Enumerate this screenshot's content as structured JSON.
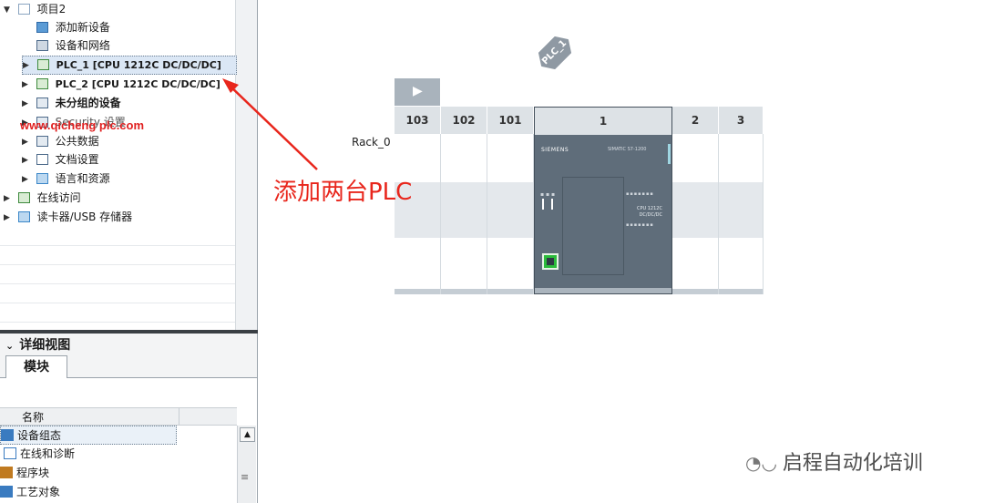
{
  "tree": {
    "items": [
      {
        "label": "项目2",
        "expander": "▼",
        "icon": "project-icon",
        "icon_color": "#8aa4c0"
      },
      {
        "label": "添加新设备",
        "icon": "add-device-icon",
        "icon_color": "#5b9bd5"
      },
      {
        "label": "设备和网络",
        "icon": "network-icon",
        "icon_color": "#4d6a8a"
      },
      {
        "label": "PLC_1 [CPU 1212C DC/DC/DC]",
        "expander": "▶",
        "icon": "plc-icon",
        "icon_color": "#3d8a3d"
      },
      {
        "label": "PLC_2 [CPU 1212C DC/DC/DC]",
        "expander": "▶",
        "icon": "plc-icon",
        "icon_color": "#3d8a3d"
      },
      {
        "label": "未分组的设备",
        "expander": "▶",
        "icon": "ungrouped-devices-icon",
        "icon_color": "#4d6a8a"
      },
      {
        "label": "Security 设置",
        "expander": "▶",
        "icon": "security-icon",
        "icon_color": "#4d6a8a"
      },
      {
        "label": "公共数据",
        "expander": "▶",
        "icon": "common-data-icon",
        "icon_color": "#4d6a8a"
      },
      {
        "label": "文档设置",
        "expander": "▶",
        "icon": "document-settings-icon",
        "icon_color": "#4d6a8a"
      },
      {
        "label": "语言和资源",
        "expander": "▶",
        "icon": "language-icon",
        "icon_color": "#3a86c8"
      },
      {
        "label": "在线访问",
        "expander": "▶",
        "icon": "online-access-icon",
        "icon_color": "#3d8a3d"
      },
      {
        "label": "读卡器/USB 存储器",
        "expander": "▶",
        "icon": "card-reader-icon",
        "icon_color": "#3a86c8"
      }
    ]
  },
  "detail": {
    "title": "详细视图",
    "chevron": "⌄",
    "tab": "模块",
    "column_name": "名称",
    "rows": [
      {
        "label": "设备组态",
        "icon": "device-config-icon",
        "icon_color": "#3a7bc0"
      },
      {
        "label": "在线和诊断",
        "icon": "diagnostics-icon",
        "icon_color": "#3a7bc0"
      },
      {
        "label": "程序块",
        "icon": "program-blocks-icon",
        "icon_color": "#c07a20"
      },
      {
        "label": "工艺对象",
        "icon": "technology-objects-icon",
        "icon_color": "#3a7bc0"
      }
    ],
    "scroll_up": "▲",
    "scroll_grip": "≡"
  },
  "device_view": {
    "plc_tag": "PLC_1",
    "play": "▶",
    "rack_label": "Rack_0",
    "slots": [
      "103",
      "102",
      "101",
      "1",
      "2",
      "3"
    ],
    "cpu": {
      "brand": "SIEMENS",
      "model": "SIMATIC S7-1200",
      "label_line1": "CPU 1212C",
      "label_line2": "DC/DC/DC",
      "accent": "#9fd6e2",
      "port_color": "#2bbb3b"
    }
  },
  "annotation": {
    "watermark": "www.qicheng plc.com",
    "callout": "添加两台PLC",
    "arrow_color": "#e8261c"
  },
  "brand": {
    "wechat_icon": "wechat-icon",
    "text": "启程自动化培训"
  }
}
